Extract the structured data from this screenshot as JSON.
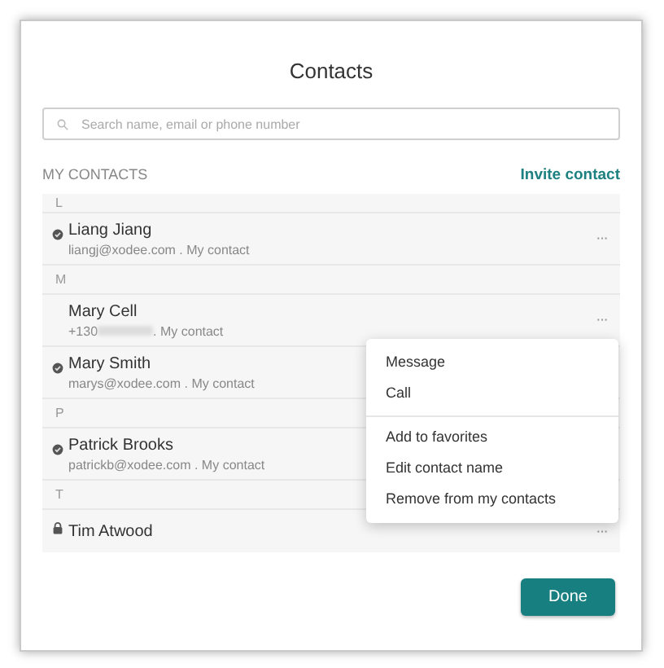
{
  "dialog": {
    "title": "Contacts",
    "search": {
      "placeholder": "Search name, email or phone number"
    },
    "section_label": "MY CONTACTS",
    "invite_link": "Invite contact",
    "list": [
      {
        "kind": "header",
        "letter": "L"
      },
      {
        "kind": "contact",
        "name": "Liang Jiang",
        "detail": "liangj@xodee.com . My contact",
        "verified": true,
        "locked": false,
        "more": "···"
      },
      {
        "kind": "header",
        "letter": "M"
      },
      {
        "kind": "contact",
        "name": "Mary Cell",
        "detail": "+130",
        "redacted": true,
        "detail_suffix": ". My contact",
        "verified": false,
        "locked": false,
        "more": "···"
      },
      {
        "kind": "contact",
        "name": "Mary Smith",
        "detail": "marys@xodee.com . My contact",
        "verified": true,
        "locked": false
      },
      {
        "kind": "header",
        "letter": "P"
      },
      {
        "kind": "contact",
        "name": "Patrick Brooks",
        "detail": "patrickb@xodee.com . My contact",
        "verified": true,
        "locked": false
      },
      {
        "kind": "header",
        "letter": "T"
      },
      {
        "kind": "contact",
        "name": "Tim Atwood",
        "verified": false,
        "locked": true,
        "more": "···"
      }
    ],
    "menu": [
      {
        "kind": "item",
        "label": "Message"
      },
      {
        "kind": "item",
        "label": "Call"
      },
      {
        "kind": "divider"
      },
      {
        "kind": "item",
        "label": "Add to favorites"
      },
      {
        "kind": "item",
        "label": "Edit contact name"
      },
      {
        "kind": "item",
        "label": "Remove from my contacts"
      }
    ],
    "done_button": "Done"
  }
}
